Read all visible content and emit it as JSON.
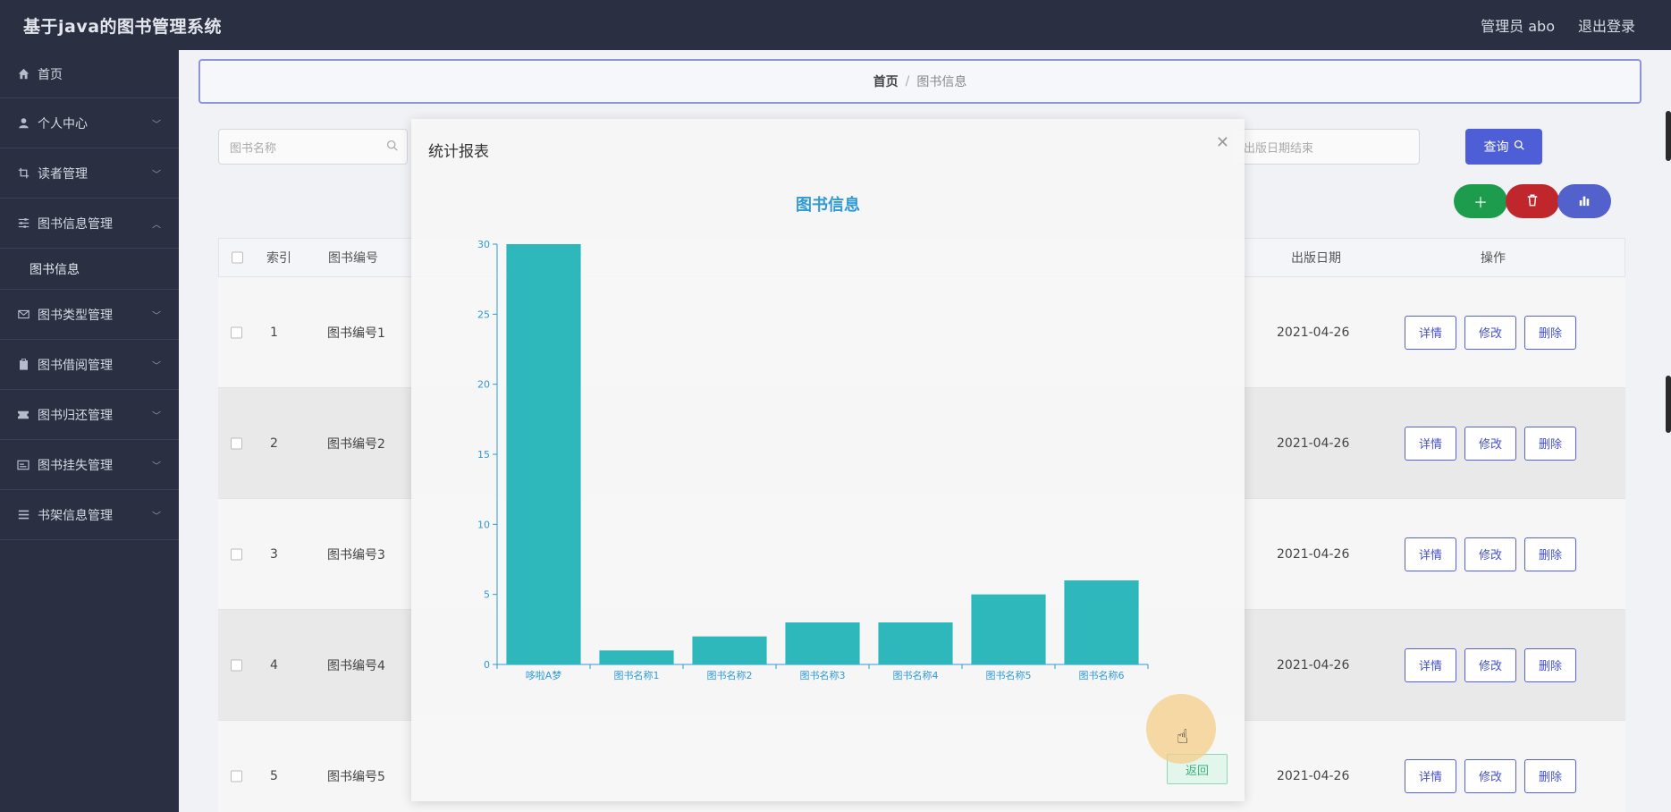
{
  "header": {
    "title": "基于java的图书管理系统",
    "admin_label": "管理员 abo",
    "logout_label": "退出登录"
  },
  "sidebar": {
    "items": [
      {
        "label": "首页",
        "icon": "home-icon"
      },
      {
        "label": "个人中心",
        "icon": "user-icon"
      },
      {
        "label": "读者管理",
        "icon": "crop-icon"
      },
      {
        "label": "图书信息管理",
        "icon": "sliders-icon"
      },
      {
        "label": "图书类型管理",
        "icon": "envelope-icon"
      },
      {
        "label": "图书借阅管理",
        "icon": "clipboard-icon"
      },
      {
        "label": "图书归还管理",
        "icon": "ticket-icon"
      },
      {
        "label": "图书挂失管理",
        "icon": "card-icon"
      },
      {
        "label": "书架信息管理",
        "icon": "list-icon"
      }
    ],
    "sub_item": "图书信息"
  },
  "breadcrumb": {
    "home": "首页",
    "separator": "/",
    "current": "图书信息"
  },
  "search": {
    "book_name_placeholder": "图书名称",
    "date_end_placeholder": "出版日期结束",
    "query_label": "查询"
  },
  "table": {
    "headers": {
      "index": "索引",
      "book_no": "图书编号",
      "pub_date": "出版日期",
      "ops": "操作"
    },
    "rows": [
      {
        "index": "1",
        "book_no": "图书编号1",
        "pub_date": "2021-04-26"
      },
      {
        "index": "2",
        "book_no": "图书编号2",
        "pub_date": "2021-04-26"
      },
      {
        "index": "3",
        "book_no": "图书编号3",
        "pub_date": "2021-04-26"
      },
      {
        "index": "4",
        "book_no": "图书编号4",
        "pub_date": "2021-04-26"
      },
      {
        "index": "5",
        "book_no": "图书编号5",
        "pub_date": "2021-04-26"
      }
    ],
    "op_labels": {
      "detail": "详情",
      "edit": "修改",
      "delete": "删除"
    }
  },
  "dialog": {
    "title": "统计报表",
    "back_label": "返回"
  },
  "chart_data": {
    "type": "bar",
    "title": "图书信息",
    "categories": [
      "哆啦A梦",
      "图书名称1",
      "图书名称2",
      "图书名称3",
      "图书名称4",
      "图书名称5",
      "图书名称6"
    ],
    "values": [
      30,
      1,
      2,
      3,
      3,
      5,
      6
    ],
    "ylim": [
      0,
      30
    ],
    "yticks": [
      0,
      5,
      10,
      15,
      20,
      25,
      30
    ],
    "bar_color": "#2fb8bb",
    "axis_color": "#2f9ad4"
  },
  "colors": {
    "sidebar_bg": "#2a3042",
    "primary": "#4e5ed6",
    "add_green": "#1e9c4d",
    "delete_red": "#c0272d",
    "chart_purple": "#5361cc"
  }
}
